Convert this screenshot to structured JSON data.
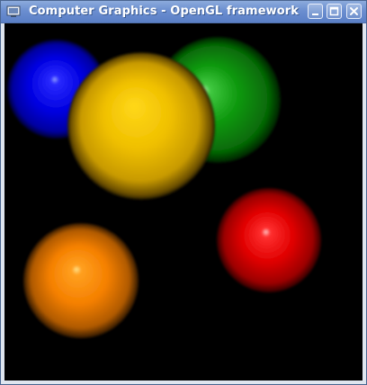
{
  "window": {
    "title": "Computer Graphics - OpenGL framework",
    "buttons": {
      "minimize": "minimize",
      "maximize": "maximize",
      "close": "close"
    }
  },
  "scene": {
    "background": "#000000",
    "spheres": [
      {
        "name": "blue-sphere",
        "color": "#0000e6"
      },
      {
        "name": "green-sphere",
        "color": "#0a8c0a"
      },
      {
        "name": "yellow-sphere",
        "color": "#f2c400"
      },
      {
        "name": "red-sphere",
        "color": "#e60000"
      },
      {
        "name": "orange-sphere",
        "color": "#ff8000"
      }
    ]
  },
  "colors": {
    "titlebar": "#6b8ed0",
    "title_text": "#ffffff"
  }
}
